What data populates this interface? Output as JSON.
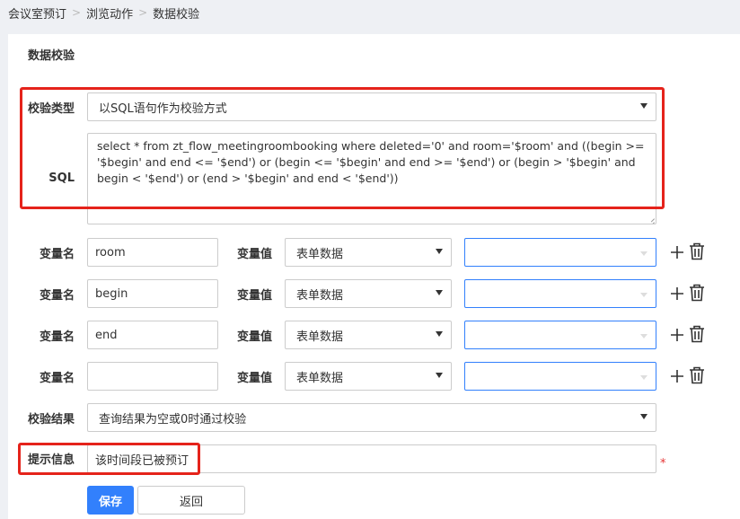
{
  "breadcrumb": [
    "会议室预订",
    "浏览动作",
    "数据校验"
  ],
  "breadcrumb_sep": ">",
  "panel_title": "数据校验",
  "form": {
    "check_type_label": "校验类型",
    "check_type_value": "以SQL语句作为校验方式",
    "sql_label": "SQL",
    "sql_value": "select * from zt_flow_meetingroombooking where deleted='0' and room='$room' and ((begin >= '$begin' and end <= '$end') or (begin <= '$begin' and end >= '$end') or (begin > '$begin' and begin < '$end') or (end > '$begin' and end < '$end'))",
    "variables": [
      {
        "name_label": "变量名",
        "name_value": "room",
        "value_label": "变量值",
        "source": "表单数据",
        "field": ""
      },
      {
        "name_label": "变量名",
        "name_value": "begin",
        "value_label": "变量值",
        "source": "表单数据",
        "field": ""
      },
      {
        "name_label": "变量名",
        "name_value": "end",
        "value_label": "变量值",
        "source": "表单数据",
        "field": ""
      },
      {
        "name_label": "变量名",
        "name_value": "",
        "value_label": "变量值",
        "source": "表单数据",
        "field": ""
      }
    ],
    "result_label": "校验结果",
    "result_value": "查询结果为空或0时通过校验",
    "message_label": "提示信息",
    "message_value": "该时间段已被预订",
    "required_mark": "*",
    "save_label": "保存",
    "back_label": "返回"
  },
  "icons": {
    "add": "plus-icon",
    "delete": "trash-icon"
  },
  "colors": {
    "primary": "#3280fc",
    "highlight": "#e5231b",
    "required": "#e53333"
  }
}
